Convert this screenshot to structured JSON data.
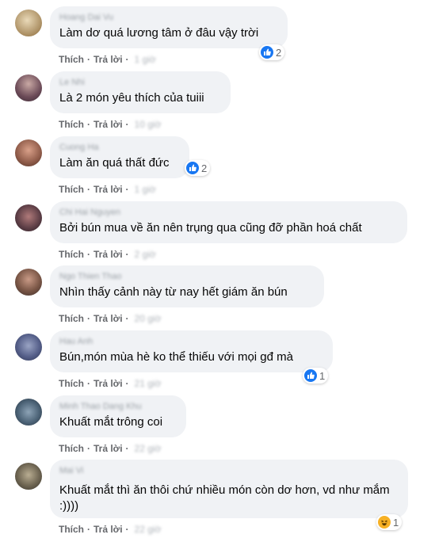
{
  "actions": {
    "like": "Thích",
    "reply": "Trả lời",
    "separator": "·"
  },
  "colors": {
    "bubble": "#f0f2f5",
    "action_text": "#65676b",
    "like_blue": "#1877f2",
    "haha_yellow": "#f7b125"
  },
  "comments": [
    {
      "author": "Hoang Dai Vu",
      "text": "Làm dơ quá lương tâm ở đâu vậy trời",
      "time": "1 giờ",
      "reaction": {
        "icon": "like-icon",
        "count": "2"
      }
    },
    {
      "author": "Le Nhi",
      "text": "Là 2 món yêu thích của tuiii",
      "time": "10 giờ"
    },
    {
      "author": "Cuong Ha",
      "text": "Làm ăn quá thất đức",
      "time": "1 giờ",
      "reaction": {
        "icon": "like-icon",
        "count": "2"
      }
    },
    {
      "author": "Chi Hai Nguyen",
      "text": "Bởi bún mua về ăn nên trụng qua cũng đỡ phần hoá chất",
      "time": "2 giờ"
    },
    {
      "author": "Ngo Thien Thao",
      "text": "Nhìn thấy cảnh này từ nay hết giám ăn bún",
      "time": "20 giờ"
    },
    {
      "author": "Hau Anh",
      "text": "Bún,món mùa hè ko thể thiếu với mọi gđ mà",
      "time": "21 giờ",
      "reaction": {
        "icon": "like-icon",
        "count": "1"
      }
    },
    {
      "author": "Minh Thao Dang Khu",
      "text": "Khuất mắt trông coi",
      "time": "22 giờ"
    },
    {
      "author": "Mai Vi",
      "text": "Khuất mắt thì ăn thôi chứ nhiều món còn dơ hơn, vd như mắm :))))",
      "time": "22 giờ",
      "reaction": {
        "icon": "haha-icon",
        "count": "1"
      }
    }
  ]
}
